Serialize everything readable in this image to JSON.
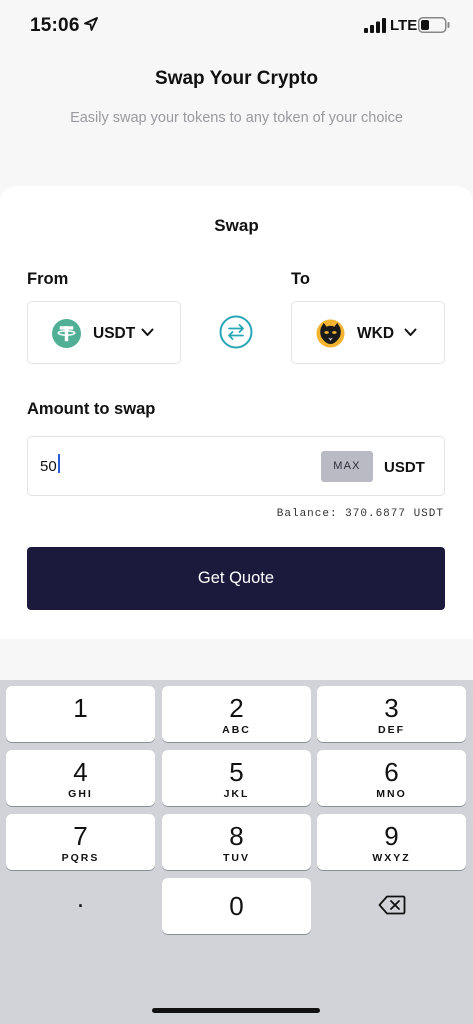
{
  "status_bar": {
    "time": "15:06",
    "network": "LTE",
    "icons": [
      "location-arrow-icon",
      "signal-icon",
      "battery-icon"
    ]
  },
  "header": {
    "title": "Swap Your Crypto",
    "subtitle": "Easily swap your tokens to any token of your choice"
  },
  "swap_card": {
    "title": "Swap",
    "from": {
      "label": "From",
      "token": "USDT",
      "icon": "tether-icon"
    },
    "to": {
      "label": "To",
      "token": "WKD",
      "icon": "wakanda-panther-icon"
    },
    "swap_direction_icon": "swap-arrows-icon",
    "amount": {
      "label": "Amount to swap",
      "value": "50",
      "max_label": "MAX",
      "unit": "USDT"
    },
    "balance": "Balance: 370.6877 USDT",
    "submit_label": "Get Quote"
  },
  "keypad": {
    "keys": [
      {
        "num": "1",
        "letters": ""
      },
      {
        "num": "2",
        "letters": "ABC"
      },
      {
        "num": "3",
        "letters": "DEF"
      },
      {
        "num": "4",
        "letters": "GHI"
      },
      {
        "num": "5",
        "letters": "JKL"
      },
      {
        "num": "6",
        "letters": "MNO"
      },
      {
        "num": "7",
        "letters": "PQRS"
      },
      {
        "num": "8",
        "letters": "TUV"
      },
      {
        "num": "9",
        "letters": "WXYZ"
      },
      {
        "num": "0",
        "letters": ""
      }
    ],
    "dot": ".",
    "backspace_icon": "backspace-icon"
  },
  "colors": {
    "primary_button": "#1b1a3d",
    "accent": "#2aa7b7",
    "tether": "#50af95",
    "max_button": "#b9bac3"
  }
}
